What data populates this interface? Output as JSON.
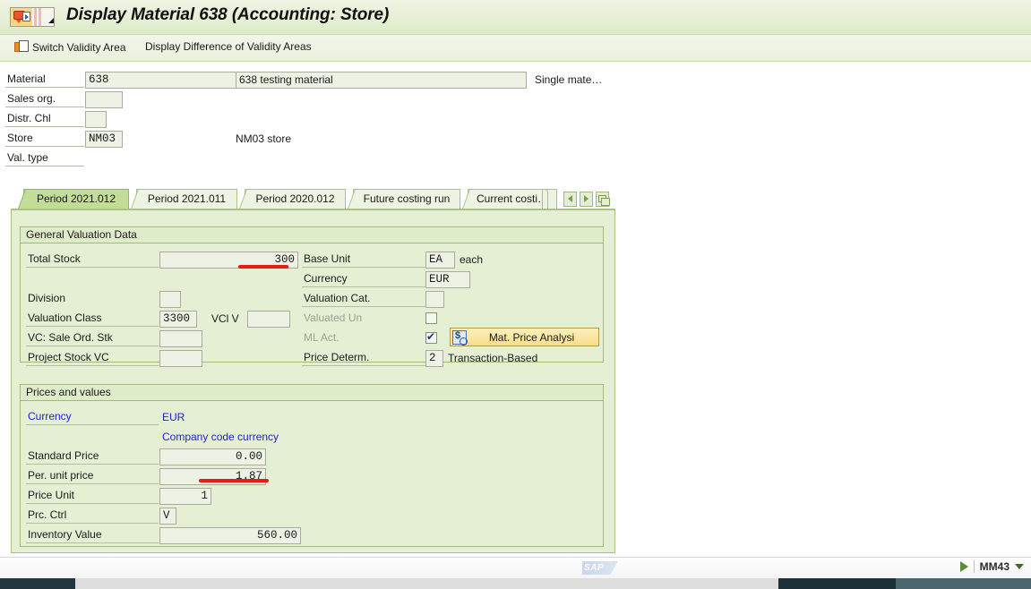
{
  "window": {
    "title": "Display Material 638 (Accounting: Store)",
    "icon": "material-master-icon"
  },
  "toolbar": {
    "switch_validity_label": "Switch Validity Area",
    "display_difference_label": "Display Difference of Validity Areas"
  },
  "header_fields": {
    "material": {
      "label": "Material",
      "value": "638",
      "description": "638 testing material",
      "suffix": "Single mate…"
    },
    "sales_org": {
      "label": "Sales org.",
      "value": ""
    },
    "distr_chl": {
      "label": "Distr. Chl",
      "value": ""
    },
    "store": {
      "label": "Store",
      "value": "NM03",
      "description": "NM03 store"
    },
    "val_type": {
      "label": "Val. type",
      "value": ""
    }
  },
  "tabs": {
    "items": [
      {
        "label": "Period 2021.012",
        "selected": true
      },
      {
        "label": "Period 2021.011",
        "selected": false
      },
      {
        "label": "Period 2020.012",
        "selected": false
      },
      {
        "label": "Future costing run",
        "selected": false
      },
      {
        "label": "Current costi…",
        "selected": false
      }
    ],
    "nav_prev": "scroll-left",
    "nav_next": "scroll-right",
    "nav_list": "tab-list"
  },
  "general_valuation": {
    "title": "General Valuation Data",
    "total_stock": {
      "label": "Total Stock",
      "value": "300"
    },
    "base_unit": {
      "label": "Base Unit",
      "value": "EA",
      "text": "each"
    },
    "currency": {
      "label": "Currency",
      "value": "EUR"
    },
    "division": {
      "label": "Division",
      "value": ""
    },
    "valuation_cat": {
      "label": "Valuation Cat.",
      "value": ""
    },
    "valuation_class": {
      "label": "Valuation Class",
      "value": "3300"
    },
    "vcl_v": {
      "label": "VCl V",
      "value": ""
    },
    "valuated_un": {
      "label": "Valuated Un",
      "checked": false
    },
    "vc_sale_ord_stk": {
      "label": "VC: Sale Ord. Stk",
      "value": ""
    },
    "ml_act": {
      "label": "ML Act.",
      "checked": true
    },
    "mat_price_analysis_button": "Mat. Price Analysi",
    "project_stock_vc": {
      "label": "Project Stock VC",
      "value": ""
    },
    "price_determ": {
      "label": "Price Determ.",
      "value": "2",
      "text": "Transaction-Based"
    }
  },
  "prices_and_values": {
    "title": "Prices and values",
    "currency": {
      "label": "Currency",
      "value": "EUR"
    },
    "company_code_currency": "Company code currency",
    "standard_price": {
      "label": "Standard Price",
      "value": "0.00"
    },
    "per_unit_price": {
      "label": "Per. unit price",
      "value": "1.87"
    },
    "price_unit": {
      "label": "Price Unit",
      "value": "1"
    },
    "prc_ctrl": {
      "label": "Prc. Ctrl",
      "value": "V"
    },
    "inventory_value": {
      "label": "Inventory Value",
      "value": "560.00"
    }
  },
  "status_bar": {
    "logo": "SAP",
    "transaction_code": "MM43",
    "run_icon": "play-icon",
    "caret_icon": "chevron-down-icon"
  },
  "annotations": {
    "highlight_color": "#e81b1b",
    "underlines": [
      "total-stock-value",
      "per-unit-price-value"
    ]
  }
}
